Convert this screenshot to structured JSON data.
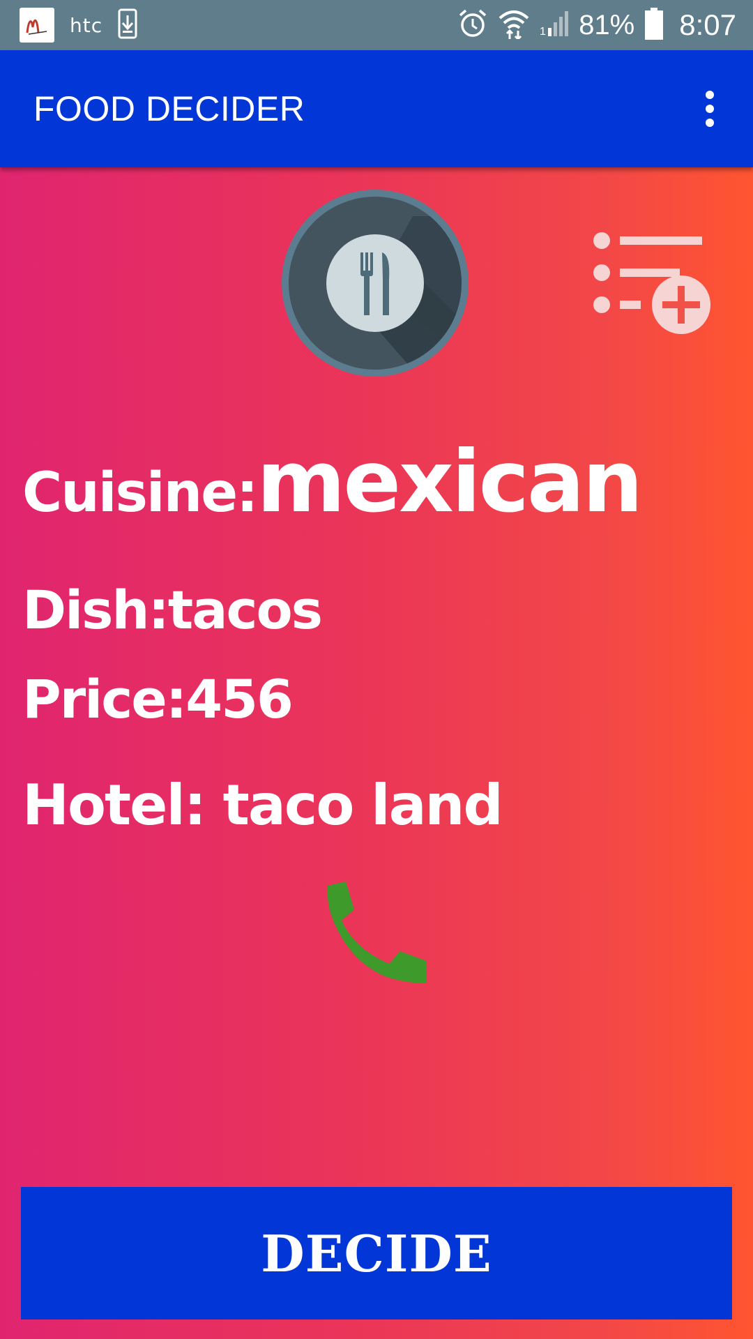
{
  "status_bar": {
    "carrier": "htc",
    "battery_percent": "81%",
    "time": "8:07",
    "icons": [
      "mcdonalds-app-icon",
      "download-icon",
      "alarm-icon",
      "wifi-icon",
      "signal-icon",
      "battery-icon"
    ]
  },
  "app_bar": {
    "title": "FOOD DECIDER",
    "menu_icon": "more-vert-icon"
  },
  "main": {
    "cuisine_label": "Cuisine:",
    "cuisine_value": "mexican",
    "dish_text": "Dish:tacos",
    "price_text": "Price:456",
    "hotel_text": "Hotel: taco land",
    "icons": [
      "plate-cutlery-icon",
      "add-to-list-icon",
      "phone-icon"
    ]
  },
  "decide_button": {
    "label": "DECIDE"
  },
  "colors": {
    "status_bar": "#607d8b",
    "primary": "#0336d6",
    "gradient_start": "#e0256f",
    "gradient_end": "#ff5530",
    "phone_green": "#3d9a2b"
  }
}
